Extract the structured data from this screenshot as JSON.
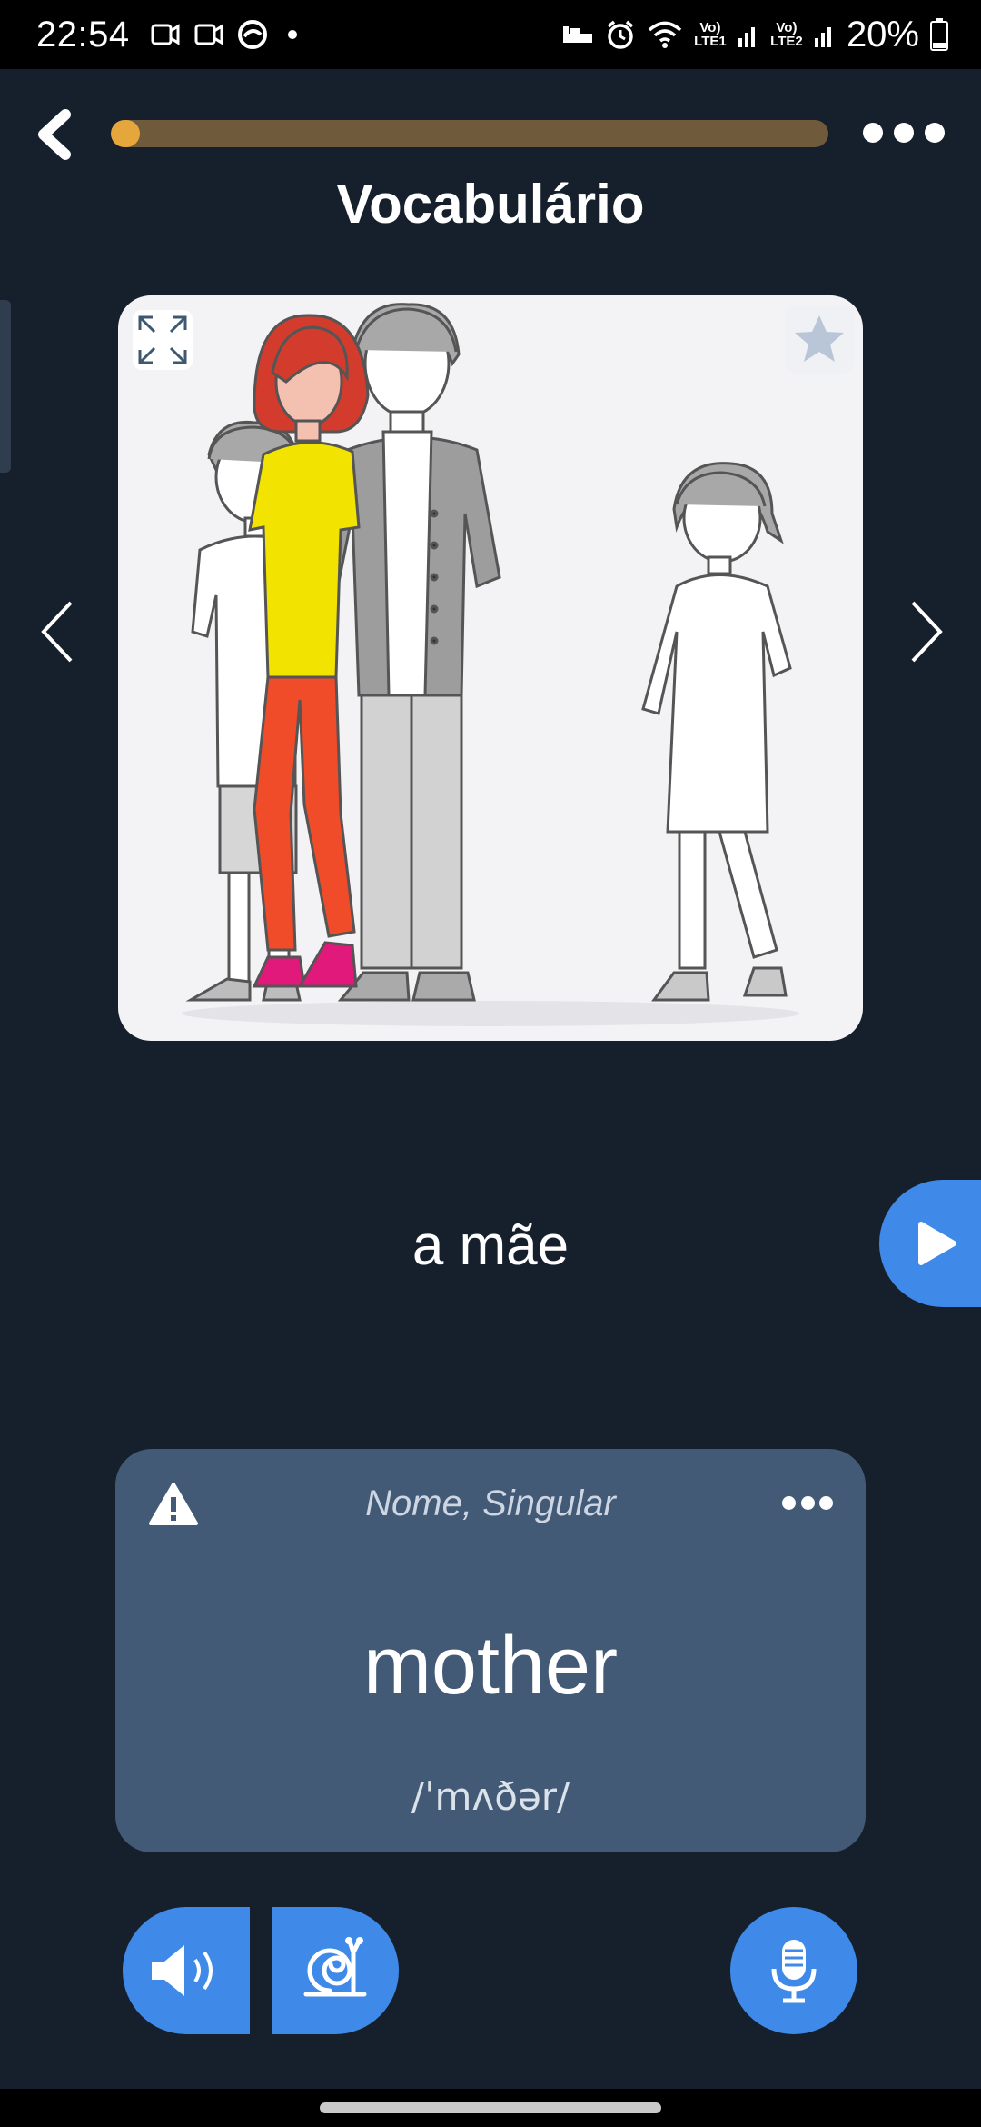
{
  "status_bar": {
    "time": "22:54",
    "lte1": "Vo) LTE1",
    "lte2": "Vo) LTE2",
    "battery": "20%"
  },
  "lesson": {
    "title": "Vocabulário",
    "progress_fraction": 0.04
  },
  "card": {
    "image_alt": "family",
    "word": "a mãe"
  },
  "translation": {
    "part_of_speech": "Nome, Singular",
    "text": "mother",
    "ipa": "/ˈmʌðər/"
  },
  "icons": {
    "back": "chevron-left-icon",
    "more": "more-dots-icon",
    "expand": "expand-icon",
    "favorite": "star-icon",
    "prev": "chevron-left-thin-icon",
    "next": "chevron-right-thin-icon",
    "play": "play-icon",
    "warning": "warning-icon",
    "audio": "speaker-icon",
    "slow_audio": "snail-icon",
    "record": "microphone-icon"
  },
  "colors": {
    "background": "#16202d",
    "accent_blue": "#3f8ae8",
    "progress_fill": "#e5a63c",
    "progress_track": "#6f5a3b",
    "card_bg": "#435a76"
  }
}
